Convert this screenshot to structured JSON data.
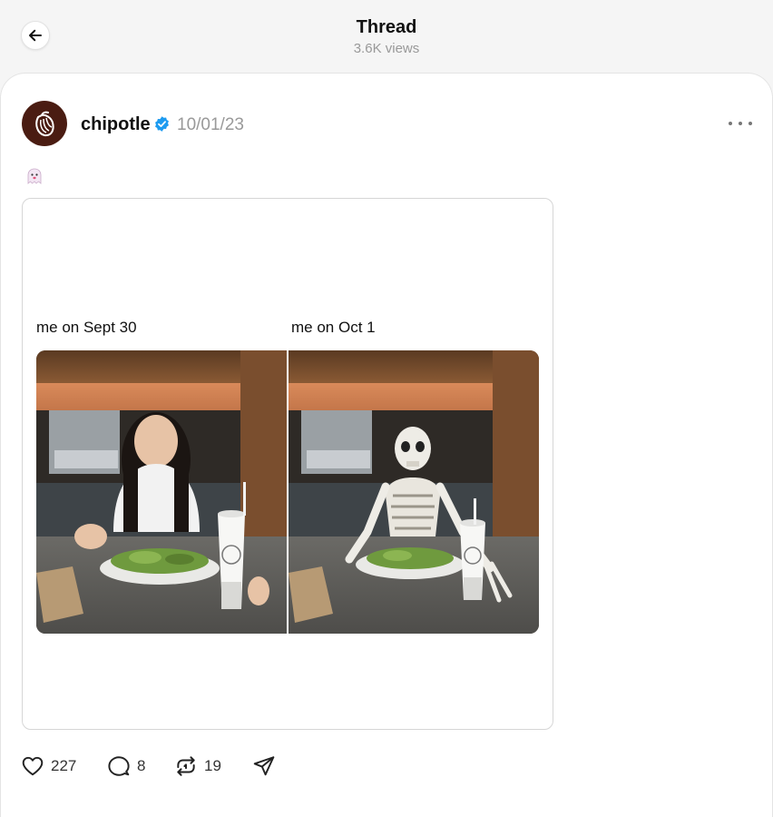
{
  "header": {
    "title": "Thread",
    "views": "3.6K views"
  },
  "post": {
    "username": "chipotle",
    "date": "10/01/23",
    "emoji": "ghost",
    "media": {
      "caption_left": "me on Sept 30",
      "caption_right": "me on Oct 1"
    }
  },
  "actions": {
    "likes": "227",
    "replies": "8",
    "reposts": "19"
  },
  "colors": {
    "verified": "#1d9bf0",
    "avatar_bg": "#4a1c12",
    "muted": "#999999"
  },
  "icons": [
    "back-arrow-icon",
    "verified-badge-icon",
    "more-icon",
    "ghost-emoji-icon",
    "heart-icon",
    "comment-icon",
    "repost-icon",
    "share-icon"
  ]
}
